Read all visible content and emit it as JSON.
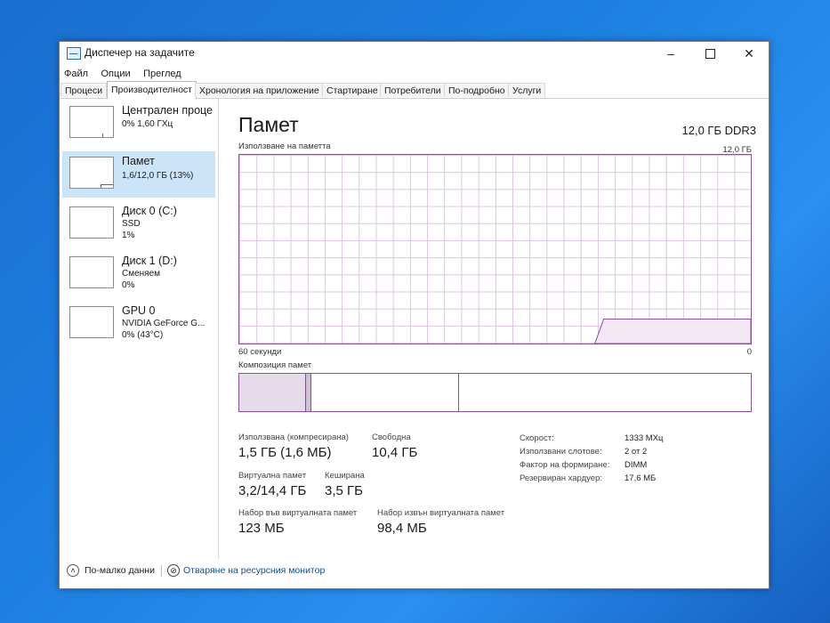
{
  "window": {
    "title": "Диспечер на задачите"
  },
  "menu": [
    "Файл",
    "Опции",
    "Преглед"
  ],
  "tabs": [
    "Процеси",
    "Производителност",
    "Хронология на приложение",
    "Стартиране",
    "Потребители",
    "По-подробно",
    "Услуги"
  ],
  "active_tab_index": 1,
  "sidebar": [
    {
      "title": "Централен проце",
      "sub1": "0% 1,60 ГХц",
      "sub2": ""
    },
    {
      "title": "Памет",
      "sub1": "1,6/12,0 ГБ (13%)",
      "sub2": ""
    },
    {
      "title": "Диск 0 (C:)",
      "sub1": "SSD",
      "sub2": "1%"
    },
    {
      "title": "Диск 1 (D:)",
      "sub1": "Сменяем",
      "sub2": "0%"
    },
    {
      "title": "GPU 0",
      "sub1": "NVIDIA GeForce G...",
      "sub2": "0% (43°C)"
    }
  ],
  "main": {
    "title": "Памет",
    "type": "12,0 ГБ DDR3",
    "usage_label": "Използване на паметта",
    "usage_max": "12,0 ГБ",
    "time_left": "60 секунди",
    "time_right": "0",
    "composition_label": "Композиция памет",
    "usage_fraction": 0.13,
    "composition": {
      "in_use_fraction": 0.13,
      "modified_fraction": 0.01,
      "standby_fraction": 0.29
    }
  },
  "stats": {
    "used_label": "Използвана (компресирана)",
    "used_value": "1,5 ГБ (1,6 МБ)",
    "free_label": "Свободна",
    "free_value": "10,4 ГБ",
    "virtual_label": "Виртуална памет",
    "virtual_value": "3,2/14,4 ГБ",
    "cached_label": "Кеширана",
    "cached_value": "3,5 ГБ",
    "paged_label": "Набор във виртуалната памет",
    "paged_value": "123 МБ",
    "nonpaged_label": "Набор извън виртуалната памет",
    "nonpaged_value": "98,4 МБ"
  },
  "details": [
    {
      "key": "Скорост:",
      "value": "1333 МХц"
    },
    {
      "key": "Използвани слотове:",
      "value": "2 от 2"
    },
    {
      "key": "Фактор на формиране:",
      "value": "DIMM"
    },
    {
      "key": "Резервиран хардуер:",
      "value": "17,6 МБ"
    }
  ],
  "footer": {
    "less_details": "По-малко данни",
    "resource_monitor": "Отваряне на ресурсния монитор"
  },
  "colors": {
    "memory_accent": "#8b4f9a",
    "memory_fill": "#f1e8f3",
    "selected_bg": "#cce4f7"
  }
}
